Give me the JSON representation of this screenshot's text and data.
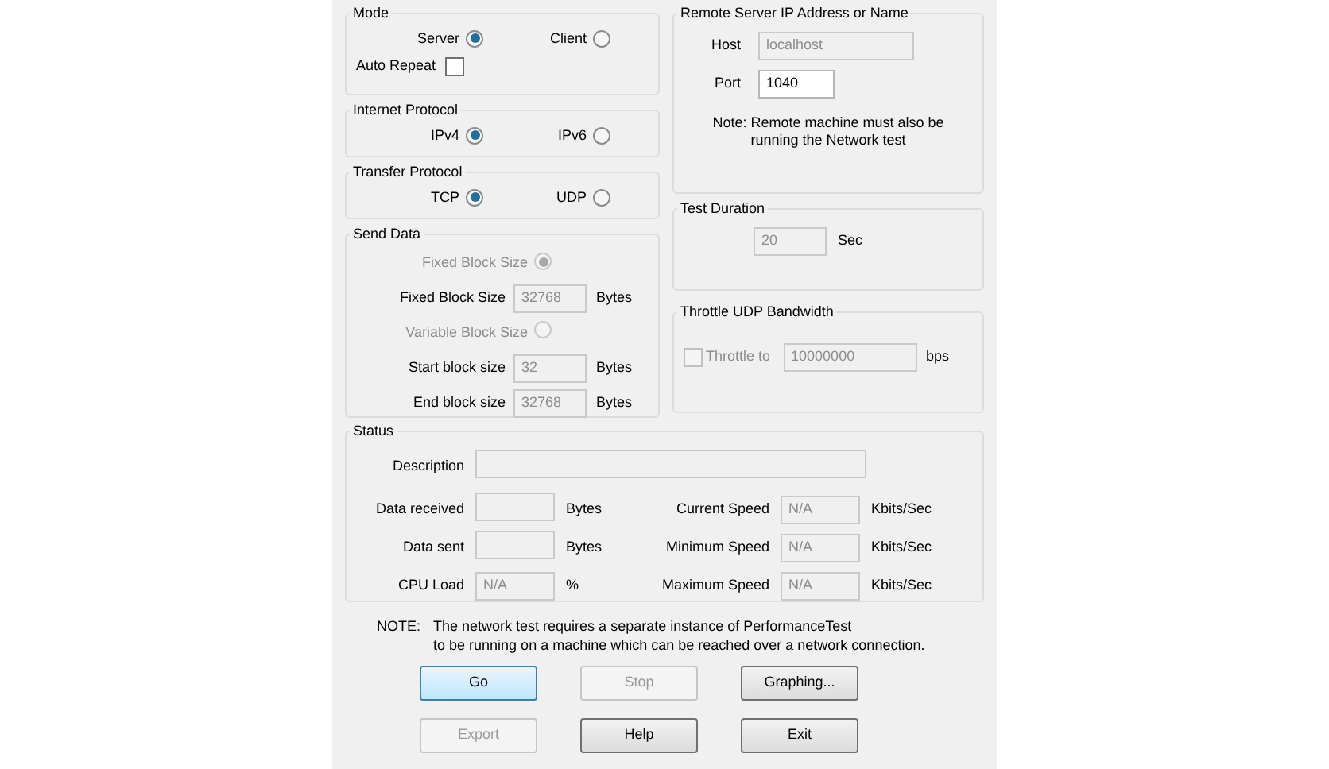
{
  "mode": {
    "title": "Mode",
    "options": [
      {
        "label": "Server",
        "selected": true
      },
      {
        "label": "Client",
        "selected": false
      }
    ],
    "auto_repeat": {
      "label": "Auto Repeat",
      "checked": false
    }
  },
  "internet_protocol": {
    "title": "Internet Protocol",
    "options": [
      {
        "label": "IPv4",
        "selected": true
      },
      {
        "label": "IPv6",
        "selected": false
      }
    ]
  },
  "transfer_protocol": {
    "title": "Transfer Protocol",
    "options": [
      {
        "label": "TCP",
        "selected": true
      },
      {
        "label": "UDP",
        "selected": false
      }
    ]
  },
  "send_data": {
    "title": "Send Data",
    "rows": [
      {
        "kind": "radio",
        "label": "Fixed Block Size",
        "selected": true,
        "disabled": true
      },
      {
        "kind": "field",
        "label": "Fixed Block Size",
        "value": "32768",
        "unit": "Bytes",
        "disabled": true
      },
      {
        "kind": "radio",
        "label": "Variable Block Size",
        "selected": false,
        "disabled": true
      },
      {
        "kind": "field",
        "label": "Start block size",
        "value": "32",
        "unit": "Bytes",
        "disabled": true
      },
      {
        "kind": "field",
        "label": "End block size",
        "value": "32768",
        "unit": "Bytes",
        "disabled": true
      }
    ]
  },
  "remote": {
    "title": "Remote Server IP Address or Name",
    "fields": [
      {
        "label": "Host",
        "value": "localhost",
        "disabled": true
      },
      {
        "label": "Port",
        "value": "1040",
        "disabled": false
      }
    ],
    "note": "Note: Remote machine must also be running the Network test"
  },
  "test_duration": {
    "title": "Test Duration",
    "value": "20",
    "unit": "Sec",
    "disabled": true
  },
  "throttle": {
    "title": "Throttle UDP Bandwidth",
    "label": "Throttle to",
    "checked": false,
    "disabled": true,
    "value": "10000000",
    "unit": "bps"
  },
  "status": {
    "title": "Status",
    "description": {
      "label": "Description"
    },
    "left": [
      {
        "label": "Data received",
        "unit": "Bytes"
      },
      {
        "label": "Data sent",
        "unit": "Bytes"
      },
      {
        "label": "CPU Load",
        "value": "N/A",
        "unit": "%"
      }
    ],
    "right": [
      {
        "label": "Current Speed",
        "value": "N/A",
        "unit": "Kbits/Sec"
      },
      {
        "label": "Minimum Speed",
        "value": "N/A",
        "unit": "Kbits/Sec"
      },
      {
        "label": "Maximum Speed",
        "value": "N/A",
        "unit": "Kbits/Sec"
      }
    ]
  },
  "note": {
    "label": "NOTE:",
    "lines": [
      "The network test requires a separate instance of PerformanceTest",
      "to be running on a machine which can be reached over a network connection."
    ]
  },
  "buttons": [
    {
      "label": "Go",
      "disabled": false,
      "default": true
    },
    {
      "label": "Stop",
      "disabled": true,
      "default": false
    },
    {
      "label": "Graphing...",
      "disabled": false,
      "default": false
    },
    {
      "label": "Export",
      "disabled": true,
      "default": false
    },
    {
      "label": "Help",
      "disabled": false,
      "default": false
    },
    {
      "label": "Exit",
      "disabled": false,
      "default": false
    }
  ]
}
